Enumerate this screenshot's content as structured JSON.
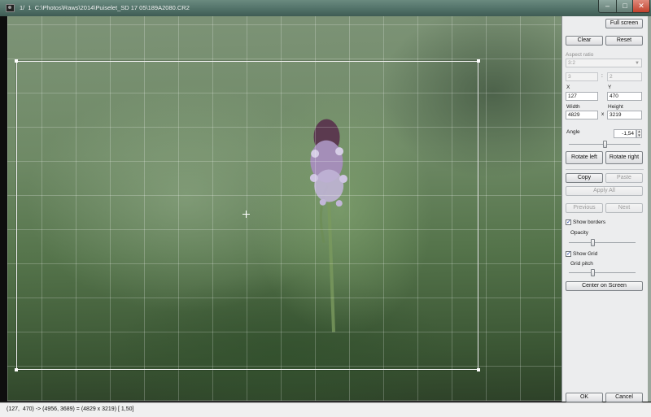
{
  "window": {
    "title": "1/  1  C:\\Photos\\Raws\\2014\\Puiselet_SD 17 05\\189A2080.CR2",
    "minimize_glyph": "–",
    "maximize_glyph": "□",
    "close_glyph": "✕"
  },
  "panel": {
    "full_screen": "Full screen",
    "clear": "Clear",
    "reset": "Reset",
    "aspect_ratio_label": "Aspect ratio",
    "aspect_ratio_value": "3:2",
    "ratio_a": "3",
    "ratio_sep": ":",
    "ratio_b": "2",
    "x_label": "X",
    "x_value": "127",
    "y_label": "Y",
    "y_value": "470",
    "width_label": "Width",
    "width_value": "4829",
    "times": "x",
    "height_label": "Height",
    "height_value": "3219",
    "angle_label": "Angle",
    "angle_value": "-1,54",
    "rotate_left": "Rotate left",
    "rotate_right": "Rotate right",
    "copy": "Copy",
    "paste": "Paste",
    "apply_all": "Apply All",
    "previous": "Previous",
    "next": "Next",
    "show_borders": "Show borders",
    "show_borders_checked": true,
    "opacity_label": "Opacity",
    "opacity_level": 0.35,
    "show_grid": "Show Grid",
    "show_grid_checked": true,
    "grid_pitch_label": "Grid pitch",
    "grid_pitch_level": 0.35,
    "angle_slider_level": 0.5,
    "center_on_screen": "Center on Screen",
    "ok": "OK",
    "cancel": "Cancel"
  },
  "status": {
    "text": "(127,  470) -> (4956, 3689) = (4829 x 3219) [ 1,50]"
  },
  "icons": {
    "app": "camera-app-icon",
    "checkbox": "checkmark-icon",
    "spin": "spin-arrows-icon",
    "dropdown": "chevron-down-icon"
  }
}
